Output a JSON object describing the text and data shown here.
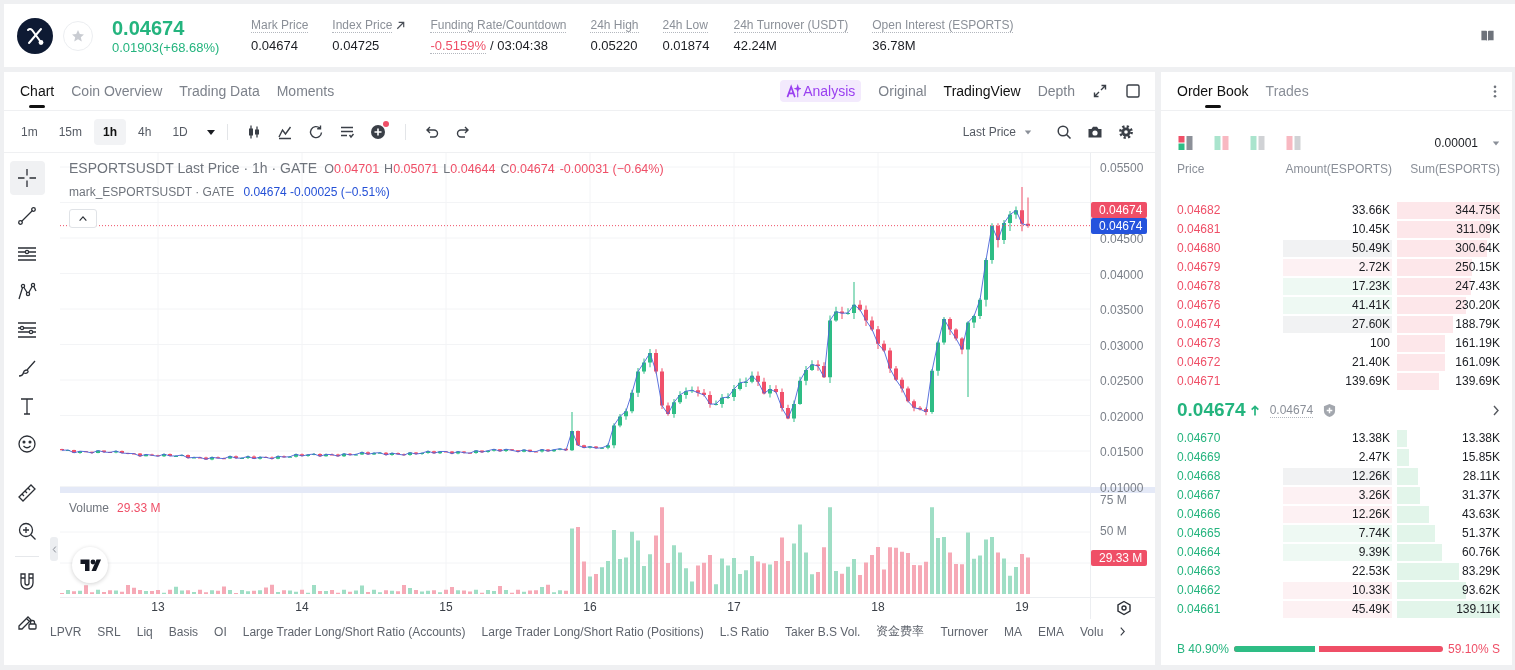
{
  "header": {
    "rising": true,
    "favorite": false,
    "price": "0.04674",
    "change": "0.01903(+68.68%)",
    "stats": [
      {
        "kind": "plain",
        "label": "Mark Price",
        "value": "0.04674"
      },
      {
        "kind": "link",
        "label": "Index Price",
        "value": "0.04725"
      },
      {
        "kind": "funding",
        "label": "Funding Rate/Countdown",
        "value": "-0.5159%",
        "countdown": "/ 03:04:38"
      },
      {
        "kind": "plain",
        "label": "24h High",
        "value": "0.05220"
      },
      {
        "kind": "plain",
        "label": "24h Low",
        "value": "0.01874"
      },
      {
        "kind": "plain",
        "label": "24h Turnover (USDT)",
        "value": "42.24M"
      },
      {
        "kind": "plain",
        "label": "Open Interest (ESPORTS)",
        "value": "36.78M"
      }
    ]
  },
  "chart_panel": {
    "tabs": [
      {
        "label": "Chart",
        "selected": true
      },
      {
        "label": "Coin Overview",
        "selected": false
      },
      {
        "label": "Trading Data",
        "selected": false
      },
      {
        "label": "Moments",
        "selected": false
      }
    ],
    "analysis": "Analysis",
    "views": [
      {
        "label": "Original",
        "selected": false
      },
      {
        "label": "TradingView",
        "selected": true
      },
      {
        "label": "Depth",
        "selected": false
      }
    ],
    "toolbar": {
      "intervals": [
        {
          "label": "1m",
          "selected": false
        },
        {
          "label": "15m",
          "selected": false
        },
        {
          "label": "1h",
          "selected": true
        },
        {
          "label": "4h",
          "selected": false
        },
        {
          "label": "1D",
          "selected": false
        }
      ],
      "indicator_dot": true,
      "price_source": "Last Price"
    },
    "drawing_tools": [
      {
        "kind": "crosshair",
        "selected": true
      },
      {
        "kind": "trendline",
        "selected": false
      },
      {
        "kind": "hlines",
        "selected": false
      },
      {
        "kind": "zigzag",
        "selected": false
      },
      {
        "kind": "fib",
        "selected": false
      },
      {
        "kind": "brush",
        "selected": false
      },
      {
        "kind": "text",
        "selected": false
      },
      {
        "kind": "emoji",
        "selected": false
      },
      {
        "kind": "ruler",
        "selected": false
      },
      {
        "kind": "zoom",
        "selected": false
      },
      {
        "kind": "magnet",
        "selected": false
      },
      {
        "kind": "lock",
        "selected": false
      }
    ],
    "legend": {
      "rising": false,
      "symbol": "ESPORTSUSDT Last Price · 1h · GATE",
      "ohlc": [
        {
          "key": "O",
          "value": "0.04701"
        },
        {
          "key": "H",
          "value": "0.05071"
        },
        {
          "key": "L",
          "value": "0.04644"
        },
        {
          "key": "C",
          "value": "0.04674"
        }
      ],
      "change": "-0.00031 (−0.64%)",
      "mark_symbol": "mark_ESPORTSUSDT · GATE",
      "mark_values": "0.04674 -0.00025 (−0.51%)"
    },
    "price_axis": [
      "0.05500",
      "0.04500",
      "0.04000",
      "0.03500",
      "0.03000",
      "0.02500",
      "0.02000",
      "0.01500",
      "0.01000"
    ],
    "last_price_tag": "0.04674",
    "mark_price_tag": "0.04674",
    "volume": {
      "label": "Volume",
      "value": "29.33 M",
      "axis": [
        "75 M",
        "50 M"
      ],
      "tag": "29.33 M"
    },
    "time_axis": [
      "13",
      "14",
      "15",
      "16",
      "17",
      "18",
      "19"
    ],
    "indicators": [
      "LPVR",
      "SRL",
      "Liq",
      "Basis",
      "OI",
      "Large Trader Long/Short Ratio (Accounts)",
      "Large Trader Long/Short Ratio (Positions)",
      "L.S Ratio",
      "Taker B.S Vol.",
      "资金费率",
      "Turnover",
      "MA",
      "EMA",
      "Volu"
    ]
  },
  "order_book": {
    "tabs": [
      {
        "label": "Order Book",
        "selected": true
      },
      {
        "label": "Trades",
        "selected": false
      }
    ],
    "layouts": [
      {
        "kind": "both",
        "selected": true
      },
      {
        "kind": "split",
        "selected": false
      },
      {
        "kind": "bids",
        "selected": false
      },
      {
        "kind": "asks",
        "selected": false
      }
    ],
    "precision": "0.00001",
    "columns": [
      "Price",
      "Amount(ESPORTS)",
      "Sum(ESPORTS)"
    ],
    "asks": [
      {
        "price": "0.04682",
        "amount": "33.66K",
        "sum": "344.75K"
      },
      {
        "price": "0.04681",
        "amount": "10.45K",
        "sum": "311.09K"
      },
      {
        "price": "0.04680",
        "amount": "50.49K",
        "sum": "300.64K",
        "color": "#f1f2f3"
      },
      {
        "price": "0.04679",
        "amount": "2.72K",
        "sum": "250.15K",
        "color": "#fdf1f3"
      },
      {
        "price": "0.04678",
        "amount": "17.23K",
        "sum": "247.43K",
        "color": "#eef9f3"
      },
      {
        "price": "0.04676",
        "amount": "41.41K",
        "sum": "230.20K",
        "color": "#eef9f3"
      },
      {
        "price": "0.04674",
        "amount": "27.60K",
        "sum": "188.79K",
        "color": "#f1f2f3"
      },
      {
        "price": "0.04673",
        "amount": "100",
        "sum": "161.19K"
      },
      {
        "price": "0.04672",
        "amount": "21.40K",
        "sum": "161.09K"
      },
      {
        "price": "0.04671",
        "amount": "139.69K",
        "sum": "139.69K"
      }
    ],
    "mid": {
      "rising": true,
      "price": "0.04674",
      "mark": "0.04674"
    },
    "bids": [
      {
        "price": "0.04670",
        "amount": "13.38K",
        "sum": "13.38K"
      },
      {
        "price": "0.04669",
        "amount": "2.47K",
        "sum": "15.85K"
      },
      {
        "price": "0.04668",
        "amount": "12.26K",
        "sum": "28.11K",
        "color": "#f1f2f3"
      },
      {
        "price": "0.04667",
        "amount": "3.26K",
        "sum": "31.37K",
        "color": "#fdf1f3"
      },
      {
        "price": "0.04666",
        "amount": "12.26K",
        "sum": "43.63K",
        "color": "#fdf1f3"
      },
      {
        "price": "0.04665",
        "amount": "7.74K",
        "sum": "51.37K",
        "color": "#eef9f3"
      },
      {
        "price": "0.04664",
        "amount": "9.39K",
        "sum": "60.76K",
        "color": "#eef9f3"
      },
      {
        "price": "0.04663",
        "amount": "22.53K",
        "sum": "83.29K"
      },
      {
        "price": "0.04662",
        "amount": "10.33K",
        "sum": "93.62K",
        "color": "#fdf1f3"
      },
      {
        "price": "0.04661",
        "amount": "45.49K",
        "sum": "139.11K",
        "color": "#fdf1f3"
      }
    ],
    "ratio": {
      "buy": "B 40.90%",
      "sell": "59.10% S",
      "level": 0.409
    }
  }
}
